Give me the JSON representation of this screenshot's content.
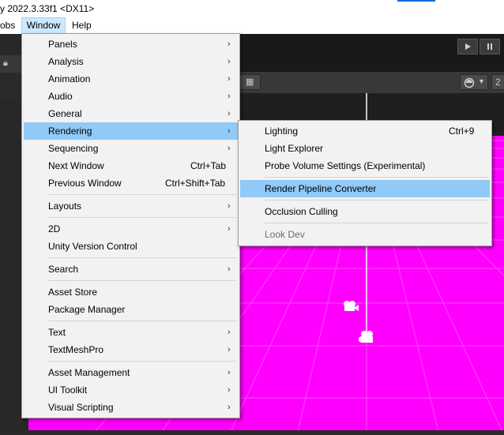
{
  "window": {
    "title": "y 2022.3.33f1 <DX11>"
  },
  "menubar": {
    "items": [
      {
        "label": "obs"
      },
      {
        "label": "Window"
      },
      {
        "label": "Help"
      }
    ]
  },
  "window_menu": {
    "items": [
      {
        "label": "Panels",
        "submenu": true
      },
      {
        "label": "Analysis",
        "submenu": true
      },
      {
        "label": "Animation",
        "submenu": true
      },
      {
        "label": "Audio",
        "submenu": true
      },
      {
        "label": "General",
        "submenu": true
      },
      {
        "label": "Rendering",
        "submenu": true,
        "highlighted": true
      },
      {
        "label": "Sequencing",
        "submenu": true
      },
      {
        "label": "Next Window",
        "shortcut": "Ctrl+Tab"
      },
      {
        "label": "Previous Window",
        "shortcut": "Ctrl+Shift+Tab"
      },
      {
        "label": "Layouts",
        "submenu": true
      },
      {
        "label": "2D",
        "submenu": true
      },
      {
        "label": "Unity Version Control"
      },
      {
        "label": "Search",
        "submenu": true
      },
      {
        "label": "Asset Store"
      },
      {
        "label": "Package Manager"
      },
      {
        "label": "Text",
        "submenu": true
      },
      {
        "label": "TextMeshPro",
        "submenu": true
      },
      {
        "label": "Asset Management",
        "submenu": true
      },
      {
        "label": "UI Toolkit",
        "submenu": true
      },
      {
        "label": "Visual Scripting",
        "submenu": true
      }
    ]
  },
  "rendering_menu": {
    "items": [
      {
        "label": "Lighting",
        "shortcut": "Ctrl+9"
      },
      {
        "label": "Light Explorer"
      },
      {
        "label": "Probe Volume Settings (Experimental)"
      },
      {
        "label": "Render Pipeline Converter",
        "highlighted": true
      },
      {
        "label": "Occlusion Culling"
      },
      {
        "label": "Look Dev",
        "disabled": true
      }
    ]
  },
  "toolbar": {
    "scene_corner_label": "2"
  },
  "colors": {
    "scene_ground": "#ff00ff",
    "menu_highlight": "#91c9f7",
    "editor_dark": "#191919"
  }
}
